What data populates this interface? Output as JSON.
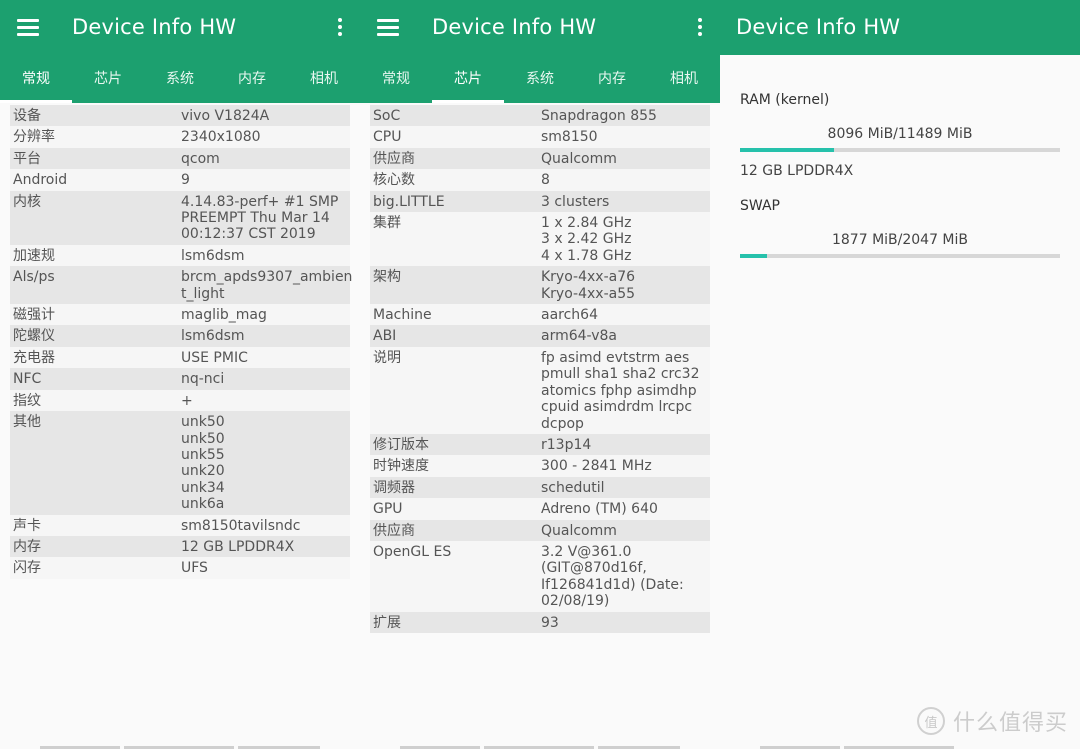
{
  "app": {
    "title": "Device Info HW"
  },
  "tabs": [
    "常规",
    "芯片",
    "系统",
    "内存",
    "相机"
  ],
  "general": {
    "active_tab": 0,
    "rows": [
      {
        "key": "设备",
        "value": [
          "vivo V1824A"
        ]
      },
      {
        "key": "分辨率",
        "value": [
          "2340x1080"
        ]
      },
      {
        "key": "平台",
        "value": [
          "qcom"
        ]
      },
      {
        "key": "Android",
        "value": [
          "9"
        ]
      },
      {
        "key": "内核",
        "value": [
          "4.14.83-perf+ #1 SMP",
          "PREEMPT Thu Mar 14",
          "00:12:37 CST 2019"
        ]
      },
      {
        "key": "加速规",
        "value": [
          "lsm6dsm"
        ]
      },
      {
        "key": "Als/ps",
        "value": [
          "brcm_apds9307_ambien",
          "t_light"
        ]
      },
      {
        "key": "磁强计",
        "value": [
          "maglib_mag"
        ]
      },
      {
        "key": "陀螺仪",
        "value": [
          "lsm6dsm"
        ]
      },
      {
        "key": "充电器",
        "value": [
          "USE PMIC"
        ]
      },
      {
        "key": "NFC",
        "value": [
          "nq-nci"
        ]
      },
      {
        "key": "指纹",
        "value": [
          "+"
        ]
      },
      {
        "key": "其他",
        "value": [
          "unk50",
          "unk50",
          "unk55",
          "unk20",
          "unk34",
          "unk6a"
        ]
      },
      {
        "key": "声卡",
        "value": [
          "sm8150tavilsndc"
        ]
      },
      {
        "key": "内存",
        "value": [
          "12 GB LPDDR4X"
        ]
      },
      {
        "key": "闪存",
        "value": [
          "UFS"
        ]
      }
    ]
  },
  "soc": {
    "active_tab": 1,
    "rows": [
      {
        "key": "SoC",
        "value": [
          "Snapdragon 855"
        ]
      },
      {
        "key": "CPU",
        "value": [
          "sm8150"
        ]
      },
      {
        "key": "供应商",
        "value": [
          "Qualcomm"
        ]
      },
      {
        "key": "核心数",
        "value": [
          "8"
        ]
      },
      {
        "key": "big.LITTLE",
        "value": [
          "3 clusters"
        ]
      },
      {
        "key": "集群",
        "value": [
          "1 x 2.84 GHz",
          "3 x 2.42 GHz",
          "4 x 1.78 GHz"
        ]
      },
      {
        "key": "架构",
        "value": [
          "Kryo-4xx-a76",
          "Kryo-4xx-a55"
        ]
      },
      {
        "key": "Machine",
        "value": [
          "aarch64"
        ]
      },
      {
        "key": "ABI",
        "value": [
          "arm64-v8a"
        ]
      },
      {
        "key": "说明",
        "value": [
          "fp asimd evtstrm aes",
          "pmull sha1 sha2 crc32",
          "atomics fphp asimdhp",
          "cpuid asimdrdm lrcpc",
          "dcpop"
        ]
      },
      {
        "key": "修订版本",
        "value": [
          "r13p14"
        ]
      },
      {
        "key": "时钟速度",
        "value": [
          "300 - 2841 MHz"
        ]
      },
      {
        "key": "调频器",
        "value": [
          "schedutil"
        ]
      },
      {
        "key": "GPU",
        "value": [
          "Adreno (TM) 640"
        ]
      },
      {
        "key": "供应商",
        "value": [
          "Qualcomm"
        ]
      },
      {
        "key": "OpenGL ES",
        "value": [
          "3.2 V@361.0",
          "(GIT@870d16f,",
          "If126841d1d) (Date:",
          "02/08/19)"
        ]
      },
      {
        "key": "扩展",
        "value": [
          "93"
        ]
      }
    ]
  },
  "memory": {
    "ram": {
      "title": "RAM (kernel)",
      "value": "8096 MiB/11489 MiB",
      "fraction": 0.295,
      "sub": "12 GB LPDDR4X"
    },
    "swap": {
      "title": "SWAP",
      "value": "1877 MiB/2047 MiB",
      "fraction": 0.083
    }
  },
  "watermark": {
    "text": "什么值得买"
  },
  "colors": {
    "appbar": "#1ca06f",
    "bar_fill": "#26c1ab",
    "bar_track": "#d7d7d7"
  },
  "icons": {
    "menu": "hamburger-menu-icon",
    "more": "more-vert-icon"
  }
}
